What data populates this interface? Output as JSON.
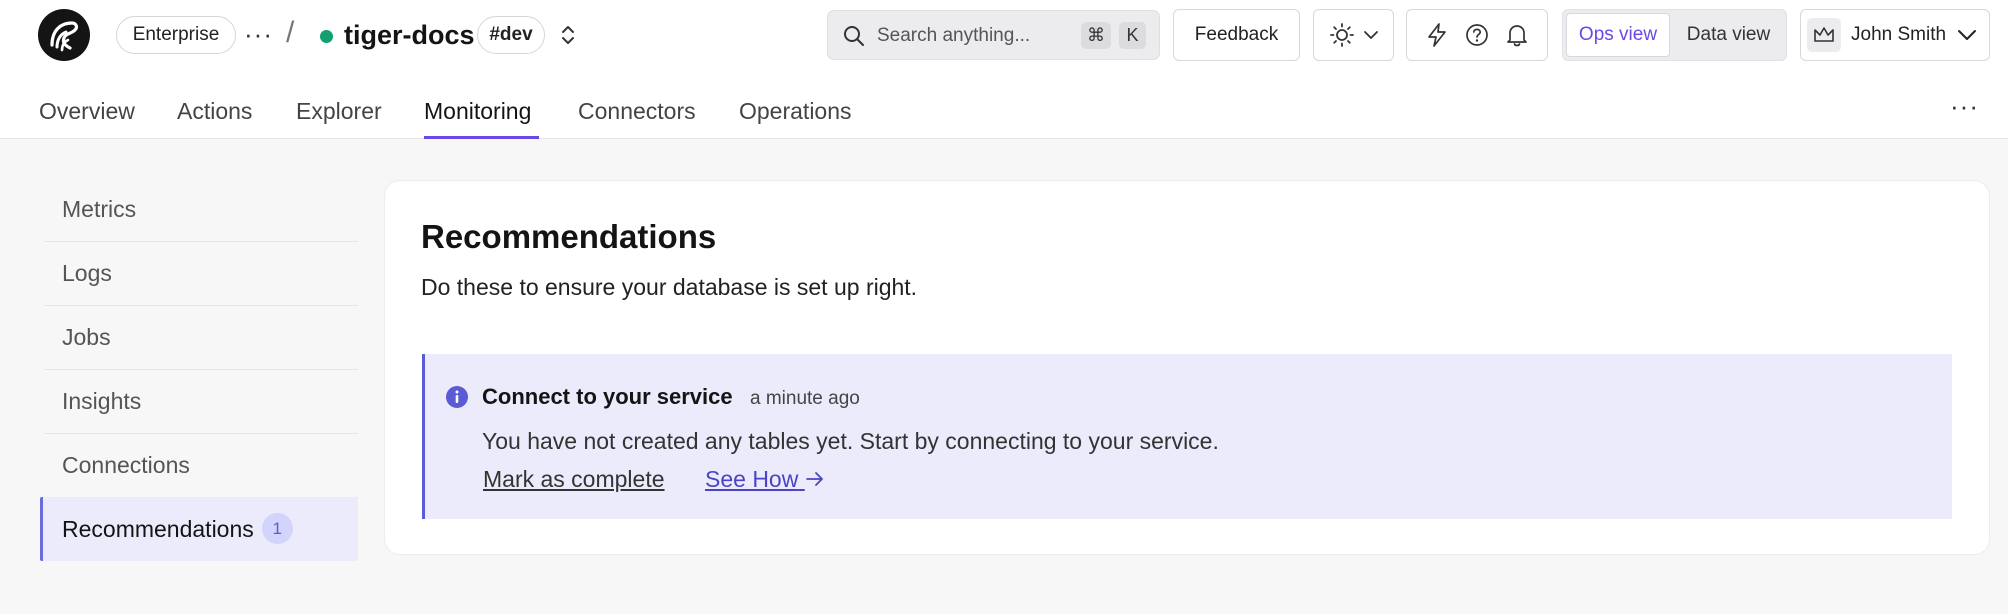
{
  "header": {
    "org_pill": "Enterprise",
    "more_icon": "ellipsis-icon",
    "separator": "/",
    "project_name": "tiger-docs",
    "env_tag": "#dev",
    "search": {
      "placeholder": "Search anything...",
      "shortcut_cmd": "⌘",
      "shortcut_key": "K"
    },
    "feedback_label": "Feedback",
    "view_toggle": {
      "active": "Ops view",
      "inactive": "Data view"
    },
    "user_name": "John Smith"
  },
  "tabs": [
    {
      "label": "Overview"
    },
    {
      "label": "Actions"
    },
    {
      "label": "Explorer"
    },
    {
      "label": "Monitoring",
      "active": true
    },
    {
      "label": "Connectors"
    },
    {
      "label": "Operations"
    }
  ],
  "sidebar": {
    "items": [
      {
        "label": "Metrics"
      },
      {
        "label": "Logs"
      },
      {
        "label": "Jobs"
      },
      {
        "label": "Insights"
      },
      {
        "label": "Connections"
      },
      {
        "label": "Recommendations",
        "badge": "1",
        "active": true
      }
    ]
  },
  "main": {
    "title": "Recommendations",
    "subtitle": "Do these to ensure your database is set up right.",
    "recommendation": {
      "title": "Connect to your service",
      "time": "a minute ago",
      "description": "You have not created any tables yet. Start by connecting to your service.",
      "mark_complete": "Mark as complete",
      "see_how": "See How"
    }
  },
  "colors": {
    "accent": "#6b48e6",
    "status_green": "#12a06f",
    "info_bg": "#ebebfb",
    "info_accent": "#5b5bd6"
  }
}
